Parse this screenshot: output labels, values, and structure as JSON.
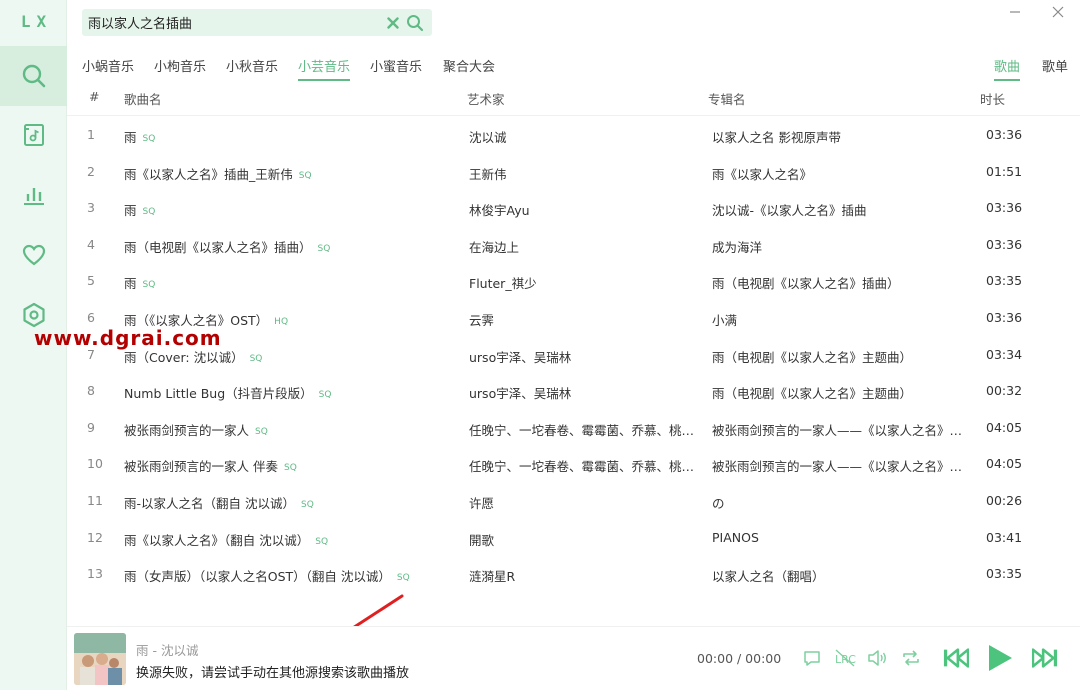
{
  "app": {
    "logo": "LX"
  },
  "sidebar": {
    "items": [
      {
        "name": "search",
        "icon": "search-icon"
      },
      {
        "name": "song-list",
        "icon": "music-file-icon"
      },
      {
        "name": "leaderboard",
        "icon": "bar-chart-icon"
      },
      {
        "name": "favorites",
        "icon": "heart-icon"
      },
      {
        "name": "settings",
        "icon": "hexagon-settings-icon"
      }
    ]
  },
  "search": {
    "value": "雨以家人之名插曲"
  },
  "source_tabs": [
    "小蜗音乐",
    "小枸音乐",
    "小秋音乐",
    "小芸音乐",
    "小蜜音乐",
    "聚合大会"
  ],
  "active_source": "小芸音乐",
  "type_tabs": [
    "歌曲",
    "歌单"
  ],
  "table": {
    "headers": {
      "num": "#",
      "name": "歌曲名",
      "artist": "艺术家",
      "album": "专辑名",
      "duration": "时长"
    },
    "rows": [
      {
        "num": "1",
        "name": "雨",
        "quality": "SQ",
        "artist": "沈以诚",
        "album": "以家人之名 影视原声带",
        "duration": "03:36"
      },
      {
        "num": "2",
        "name": "雨《以家人之名》插曲_王新伟",
        "quality": "SQ",
        "artist": "王新伟",
        "album": "雨《以家人之名》",
        "duration": "01:51"
      },
      {
        "num": "3",
        "name": "雨",
        "quality": "SQ",
        "artist": "林俊宇Ayu",
        "album": "沈以诚-《以家人之名》插曲",
        "duration": "03:36"
      },
      {
        "num": "4",
        "name": "雨（电视剧《以家人之名》插曲）",
        "quality": "SQ",
        "artist": "在海边上",
        "album": "成为海洋",
        "duration": "03:36"
      },
      {
        "num": "5",
        "name": "雨",
        "quality": "SQ",
        "artist": "Fluter_祺少",
        "album": "雨（电视剧《以家人之名》插曲）",
        "duration": "03:35"
      },
      {
        "num": "6",
        "name": "雨（《以家人之名》OST）",
        "quality": "HQ",
        "artist": "云霁",
        "album": "小满",
        "duration": "03:36"
      },
      {
        "num": "7",
        "name": "雨（Cover: 沈以诚）",
        "quality": "SQ",
        "artist": "urso宇泽、吴瑞林",
        "album": "雨（电视剧《以家人之名》主题曲）",
        "duration": "03:34"
      },
      {
        "num": "8",
        "name": "Numb Little Bug（抖音片段版）",
        "quality": "SQ",
        "artist": "urso宇泽、吴瑞林",
        "album": "雨（电视剧《以家人之名》主题曲）",
        "duration": "00:32"
      },
      {
        "num": "9",
        "name": "被张雨剑预言的一家人",
        "quality": "SQ",
        "artist": "任晚宁、一坨春卷、霉霉菌、乔慕、桃与...",
        "album": "被张雨剑预言的一家人——《以家人之名》原创...",
        "duration": "04:05"
      },
      {
        "num": "10",
        "name": "被张雨剑预言的一家人 伴奏",
        "quality": "SQ",
        "artist": "任晚宁、一坨春卷、霉霉菌、乔慕、桃与...",
        "album": "被张雨剑预言的一家人——《以家人之名》原创...",
        "duration": "04:05"
      },
      {
        "num": "11",
        "name": "雨-以家人之名（翻自 沈以诚）",
        "quality": "SQ",
        "artist": "许愿",
        "album": "の",
        "duration": "00:26"
      },
      {
        "num": "12",
        "name": "雨《以家人之名》（翻自 沈以诚）",
        "quality": "SQ",
        "artist": "開歌",
        "album": "PIANOS",
        "duration": "03:41"
      },
      {
        "num": "13",
        "name": "雨（女声版）（以家人之名OST）（翻自 沈以诚）",
        "quality": "SQ",
        "artist": "涟漪星R",
        "album": "以家人之名（翻唱）",
        "duration": "03:35"
      }
    ]
  },
  "watermark": "www.dgrai.com",
  "player": {
    "title": "雨 - 沈以诚",
    "message": "换源失败，请尝试手动在其他源搜索该歌曲播放",
    "time": "00:00 / 00:00"
  },
  "colors": {
    "accent": "#5fba85",
    "sidebar_bg": "#eef8f2",
    "search_bg": "#e6f5ec"
  }
}
